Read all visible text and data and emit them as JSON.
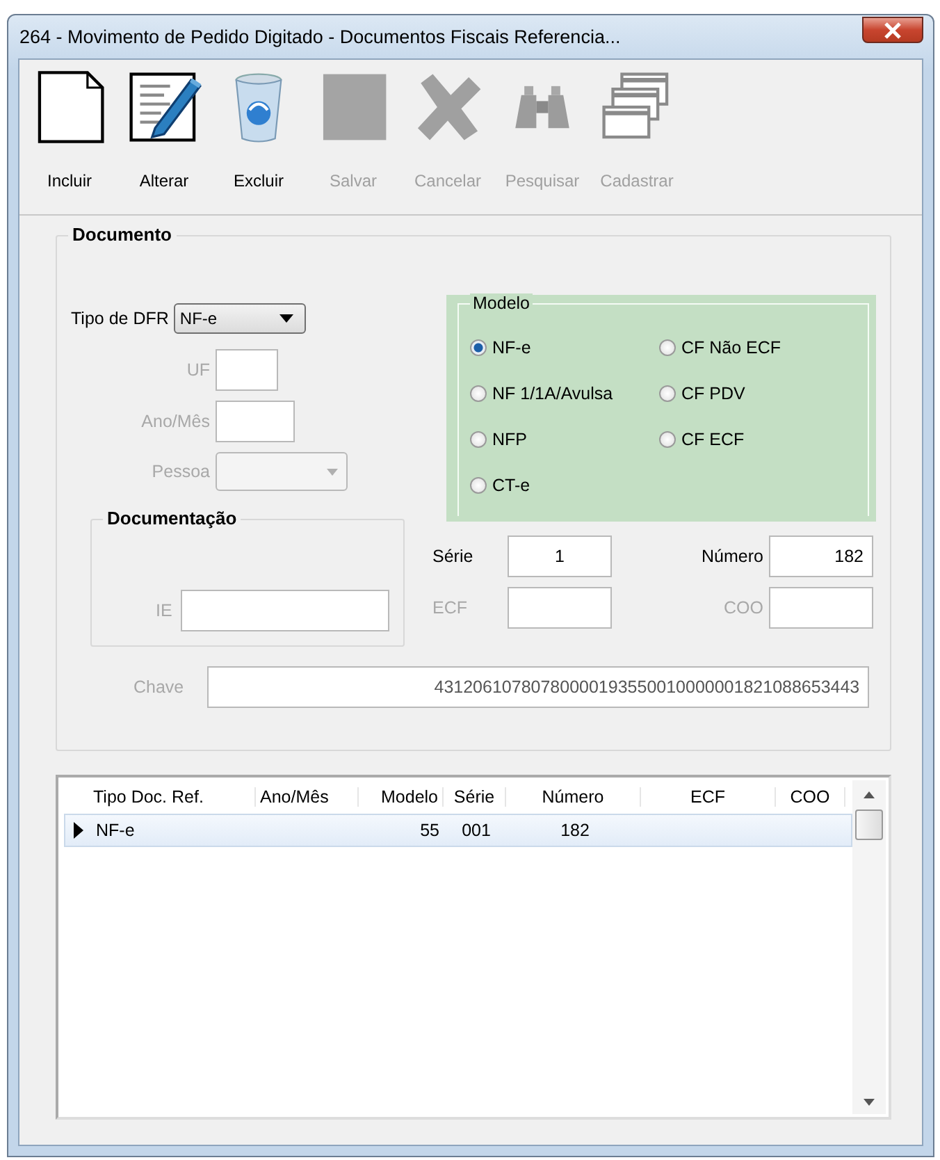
{
  "window": {
    "title": "264 - Movimento de Pedido Digitado - Documentos Fiscais Referencia..."
  },
  "toolbar": [
    {
      "label": "Incluir",
      "disabled": false
    },
    {
      "label": "Alterar",
      "disabled": false
    },
    {
      "label": "Excluir",
      "disabled": false
    },
    {
      "label": "Salvar",
      "disabled": true
    },
    {
      "label": "Cancelar",
      "disabled": true
    },
    {
      "label": "Pesquisar",
      "disabled": true
    },
    {
      "label": "Cadastrar",
      "disabled": true
    }
  ],
  "documento": {
    "title": "Documento",
    "tipo_dfr": {
      "label": "Tipo de DFR",
      "value": "NF-e"
    },
    "uf": {
      "label": "UF",
      "disabled": true
    },
    "ano_mes": {
      "label": "Ano/Mês",
      "disabled": true
    },
    "pessoa": {
      "label": "Pessoa",
      "disabled": true
    },
    "documentacao": {
      "title": "Documentação",
      "ie": {
        "label": "IE",
        "disabled": true
      }
    },
    "modelo": {
      "title": "Modelo",
      "options": [
        {
          "label": "NF-e",
          "selected": true
        },
        {
          "label": "CF Não ECF",
          "selected": false
        },
        {
          "label": "NF 1/1A/Avulsa",
          "selected": false
        },
        {
          "label": "CF PDV",
          "selected": false
        },
        {
          "label": "NFP",
          "selected": false
        },
        {
          "label": "CF ECF",
          "selected": false
        },
        {
          "label": "CT-e",
          "selected": false
        }
      ]
    },
    "serie": {
      "label": "Série",
      "value": "1",
      "disabled": false
    },
    "numero": {
      "label": "Número",
      "value": "182",
      "disabled": false
    },
    "ecf": {
      "label": "ECF",
      "disabled": true
    },
    "coo": {
      "label": "COO",
      "disabled": true
    },
    "chave": {
      "label": "Chave",
      "value": "43120610780780000193550010000001821088653443",
      "disabled": true
    }
  },
  "grid": {
    "columns": [
      "Tipo Doc. Ref.",
      "Ano/Mês",
      "Modelo",
      "Série",
      "Número",
      "ECF",
      "COO"
    ],
    "rows": [
      {
        "selected": true,
        "tipo_doc_ref": "NF-e",
        "modelo": "55",
        "serie": "001",
        "numero": "182"
      }
    ]
  }
}
